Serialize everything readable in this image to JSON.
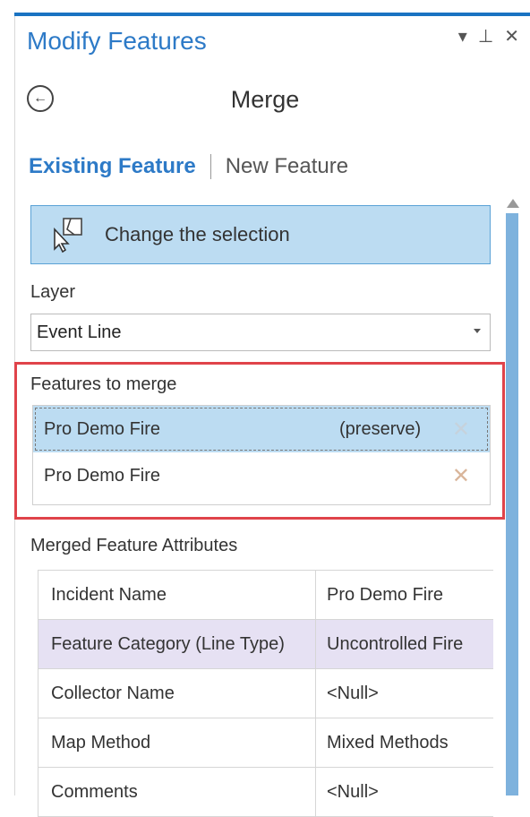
{
  "pane": {
    "title": "Modify Features",
    "controls": {
      "dropdown": "▾",
      "pin": "⊥",
      "close": "✕"
    }
  },
  "tool": {
    "title": "Merge",
    "back_icon": "←"
  },
  "tabs": {
    "active": "Existing Feature",
    "inactive": "New Feature"
  },
  "change_selection": {
    "label": "Change the selection"
  },
  "layer": {
    "label": "Layer",
    "value": "Event Line"
  },
  "features_to_merge": {
    "label": "Features to merge",
    "items": [
      {
        "name": "Pro Demo Fire",
        "tag": "(preserve)",
        "remove": "✕"
      },
      {
        "name": "Pro Demo Fire",
        "tag": "",
        "remove": "✕"
      }
    ]
  },
  "merged_attributes": {
    "label": "Merged Feature Attributes",
    "rows": [
      {
        "name": "Incident Name",
        "value": "Pro Demo Fire"
      },
      {
        "name": "Feature Category (Line Type)",
        "value": "Uncontrolled Fire"
      },
      {
        "name": "Collector Name",
        "value": "<Null>"
      },
      {
        "name": "Map Method",
        "value": "Mixed Methods"
      },
      {
        "name": "Comments",
        "value": "<Null>"
      }
    ]
  },
  "colors": {
    "accent": "#2d7ac7",
    "selection": "#bcdcf2",
    "highlight_border": "#e0434a",
    "row_highlight": "#e6e1f3"
  }
}
